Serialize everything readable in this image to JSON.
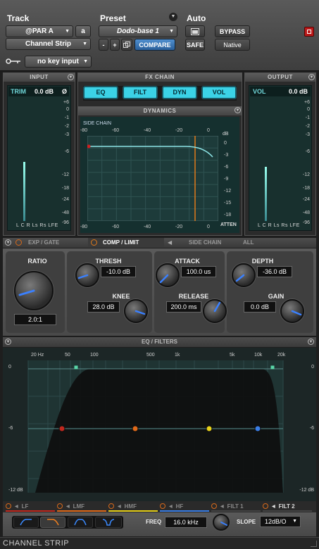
{
  "header": {
    "track_title": "Track",
    "preset_title": "Preset",
    "auto_title": "Auto",
    "track_name": "@PAR A",
    "track_channel": "a",
    "plugin_name": "Channel Strip",
    "preset_name": "Dodo-base 1",
    "minus_label": "-",
    "plus_label": "+",
    "compare_label": "COMPARE",
    "bypass_label": "BYPASS",
    "safe_label": "SAFE",
    "native_label": "Native",
    "key_input": "no key input"
  },
  "input": {
    "title": "INPUT",
    "trim_label": "TRIM",
    "trim_value": "0.0 dB",
    "phase_symbol": "Ø",
    "scale": [
      "+6",
      "0",
      "-1",
      "-2",
      "-3",
      "-6",
      "-12",
      "-18",
      "-24",
      "-48",
      "-96"
    ],
    "channels": "L C R Ls Rs LFE"
  },
  "output": {
    "title": "OUTPUT",
    "vol_label": "VOL",
    "vol_value": "0.0 dB",
    "scale": [
      "+6",
      "0",
      "-1",
      "-2",
      "-3",
      "-6",
      "-12",
      "-18",
      "-24",
      "-48",
      "-96"
    ],
    "channels": "L C R Ls Rs LFE"
  },
  "fxchain": {
    "title": "FX CHAIN",
    "buttons": [
      "EQ",
      "FILT",
      "DYN",
      "VOL"
    ]
  },
  "dynamics": {
    "title": "DYNAMICS",
    "side_chain_label": "SIDE CHAIN",
    "top_scale": [
      "-80",
      "-60",
      "-40",
      "-20",
      "0"
    ],
    "db_label": "dB",
    "right_scale": [
      "0",
      "-3",
      "-6",
      "-9",
      "-12",
      "-15",
      "-18"
    ],
    "bottom_scale": [
      "-80",
      "-60",
      "-40",
      "-20",
      "0"
    ],
    "atten_label": "ATTEN"
  },
  "dyn_tabs": [
    "EXP / GATE",
    "COMP / LIMIT",
    "SIDE CHAIN",
    "ALL"
  ],
  "comp": {
    "ratio_label": "RATIO",
    "ratio_value": "2.0:1",
    "thresh_label": "THRESH",
    "thresh_value": "-10.0 dB",
    "knee_label": "KNEE",
    "knee_value": "28.0 dB",
    "attack_label": "ATTACK",
    "attack_value": "100.0 us",
    "release_label": "RELEASE",
    "release_value": "200.0 ms",
    "depth_label": "DEPTH",
    "depth_value": "-36.0 dB",
    "gain_label": "GAIN",
    "gain_value": "0.0 dB"
  },
  "eq": {
    "title": "EQ / FILTERS",
    "freq_scale": [
      "20 Hz",
      "50",
      "100",
      "500",
      "1k",
      "5k",
      "10k",
      "20k"
    ],
    "db_scale_left": [
      "0",
      "-6",
      "-12 dB"
    ],
    "db_scale_right": [
      "0",
      "-6",
      "-12 dB"
    ],
    "bands": [
      "LF",
      "LMF",
      "HMF",
      "HF",
      "FILT 1",
      "FILT 2"
    ],
    "band_colors": [
      "#c0281e",
      "#e06a1a",
      "#e8d21a",
      "#3a7ee6",
      "#444",
      "#444"
    ],
    "freq_label": "FREQ",
    "freq_value": "16.0 kHz",
    "slope_label": "SLOPE",
    "slope_value": "12dB/O"
  },
  "footer": {
    "title": "CHANNEL STRIP"
  }
}
